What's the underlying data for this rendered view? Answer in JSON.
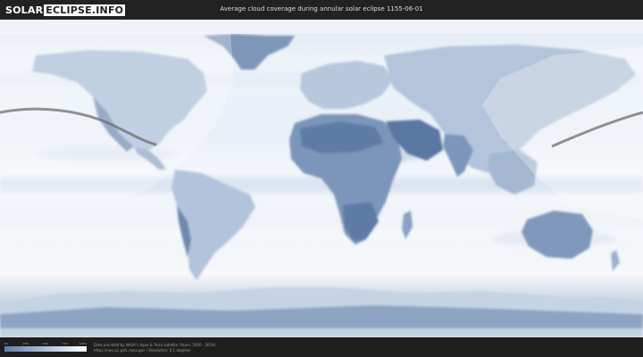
{
  "header": {
    "logo_left": "SOLAR",
    "logo_right": "ECLIPSE.INFO",
    "title": "Average cloud coverage during annular solar eclipse 1155-06-01"
  },
  "legend": {
    "ticks": [
      "0%",
      "25%",
      "50%",
      "75%",
      "100%"
    ],
    "colors": {
      "low": "#5d7ea8",
      "mid": "#c3d3e5",
      "high": "#ffffff"
    }
  },
  "credits": {
    "line1": "Data provided by NASA's Aqua & Terra satellite (Years: 2000 - 2019)",
    "line2": "https://neo.sci.gsfc.nasa.gov  |  Resolution: 0.1 degrees"
  },
  "map": {
    "projection": "equirectangular",
    "eclipse_path": "annular"
  }
}
